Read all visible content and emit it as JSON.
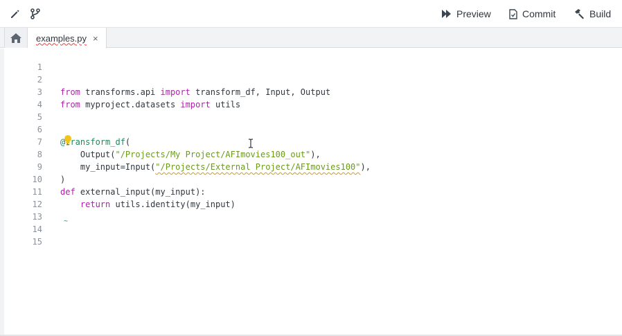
{
  "toolbar": {
    "left_icons": [
      "pencil-icon",
      "git-branch-icon"
    ],
    "preview_label": "Preview",
    "commit_label": "Commit",
    "build_label": "Build"
  },
  "tabs": {
    "home_icon": "home-icon",
    "file_tab": {
      "label": "examples.py",
      "close": "×"
    }
  },
  "editor": {
    "line_numbers": [
      "1",
      "2",
      "3",
      "4",
      "5",
      "6",
      "7",
      "8",
      "9",
      "10",
      "11",
      "12",
      "13",
      "14",
      "15"
    ],
    "lines": {
      "l2": {
        "kw1": "from",
        "t1": " transforms.api ",
        "kw2": "import",
        "t2": " transform_df, Input, Output"
      },
      "l3": {
        "kw1": "from",
        "t1": " myproject.datasets ",
        "kw2": "import",
        "t2": " utils"
      },
      "l6": {
        "dec": "@transform_df",
        "t1": "("
      },
      "l7": {
        "t1": "    Output(",
        "str": "\"/Projects/My Project/AFImovies100_out\"",
        "t2": "),"
      },
      "l8": {
        "t1": "    my_input=Input(",
        "str": "\"/Projects/External Project/AFImovies100\"",
        "t2": "),"
      },
      "l9": {
        "t1": ")"
      },
      "l10": {
        "kw1": "def",
        "t1": " external_input(my_input):"
      },
      "l11": {
        "t0": "    ",
        "kw1": "return",
        "t1": " utils.identity(my_input)"
      },
      "l15_marker": "~"
    },
    "icons": [
      "lightbulb-icon",
      "text-cursor-icon"
    ]
  }
}
